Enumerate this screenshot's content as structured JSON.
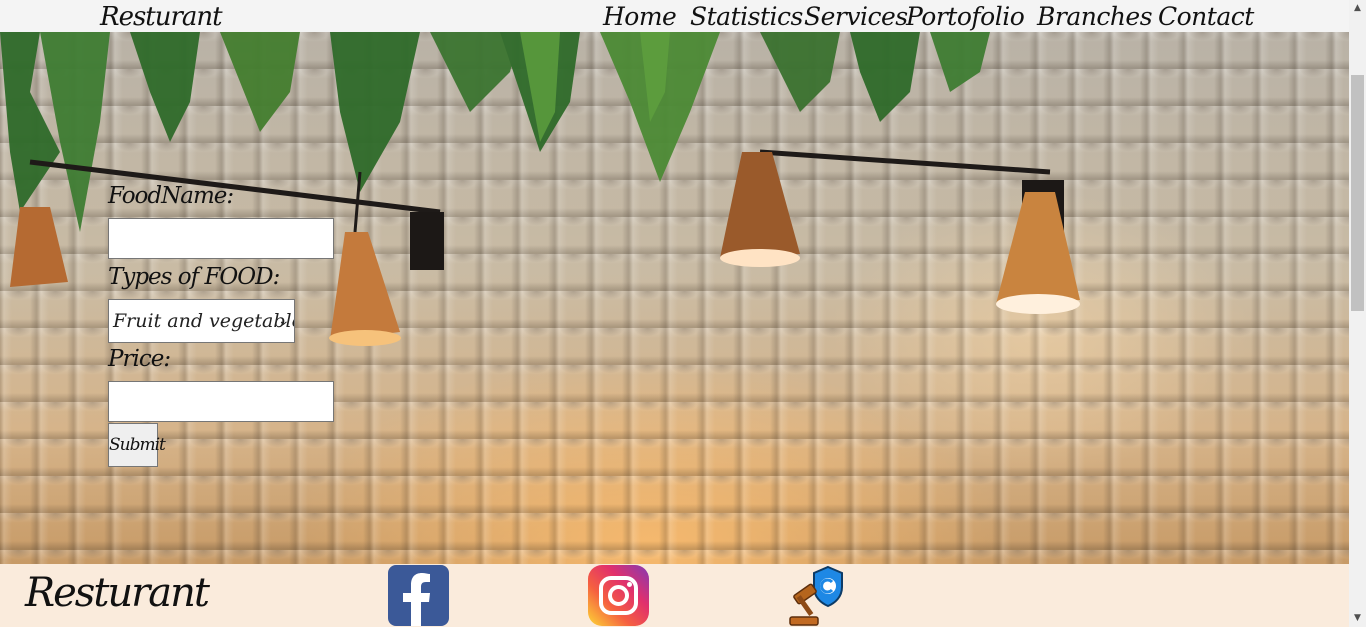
{
  "navbar": {
    "brand": "Resturant",
    "links": [
      "Home",
      "Statistics",
      "Services",
      "Portofolio",
      "Branches",
      "Contact"
    ]
  },
  "form": {
    "food_name_label": "FoodName:",
    "food_name_value": "",
    "types_label": "Types of FOOD:",
    "types_selected": "Fruit and vegetables.",
    "price_label": "Price:",
    "price_value": "",
    "submit_label": "Submit"
  },
  "footer": {
    "brand": "Resturant",
    "icons": [
      "facebook-icon",
      "instagram-icon",
      "copyright-law-icon"
    ],
    "colors": {
      "facebook": "#3b5998",
      "background": "#faebdc"
    }
  }
}
